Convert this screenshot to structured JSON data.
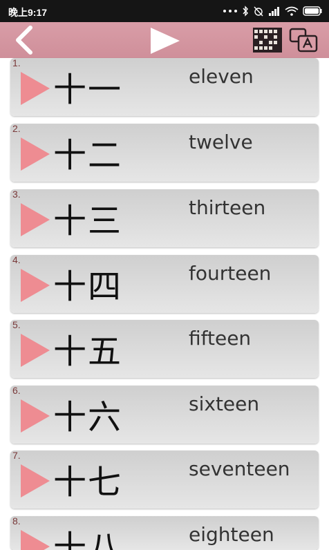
{
  "status_bar": {
    "time": "晚上9:17"
  },
  "toolbar": {},
  "items": [
    {
      "num": "1.",
      "hanzi": "十一",
      "english": "eleven"
    },
    {
      "num": "2.",
      "hanzi": "十二",
      "english": "twelve"
    },
    {
      "num": "3.",
      "hanzi": "十三",
      "english": "thirteen"
    },
    {
      "num": "4.",
      "hanzi": "十四",
      "english": "fourteen"
    },
    {
      "num": "5.",
      "hanzi": "十五",
      "english": "fifteen"
    },
    {
      "num": "6.",
      "hanzi": "十六",
      "english": "sixteen"
    },
    {
      "num": "7.",
      "hanzi": "十七",
      "english": "seventeen"
    },
    {
      "num": "8.",
      "hanzi": "十八",
      "english": "eighteen"
    }
  ],
  "colors": {
    "toolbar": "#d99da7",
    "play_triangle": "#ee8c92",
    "status_bar": "#151515"
  }
}
